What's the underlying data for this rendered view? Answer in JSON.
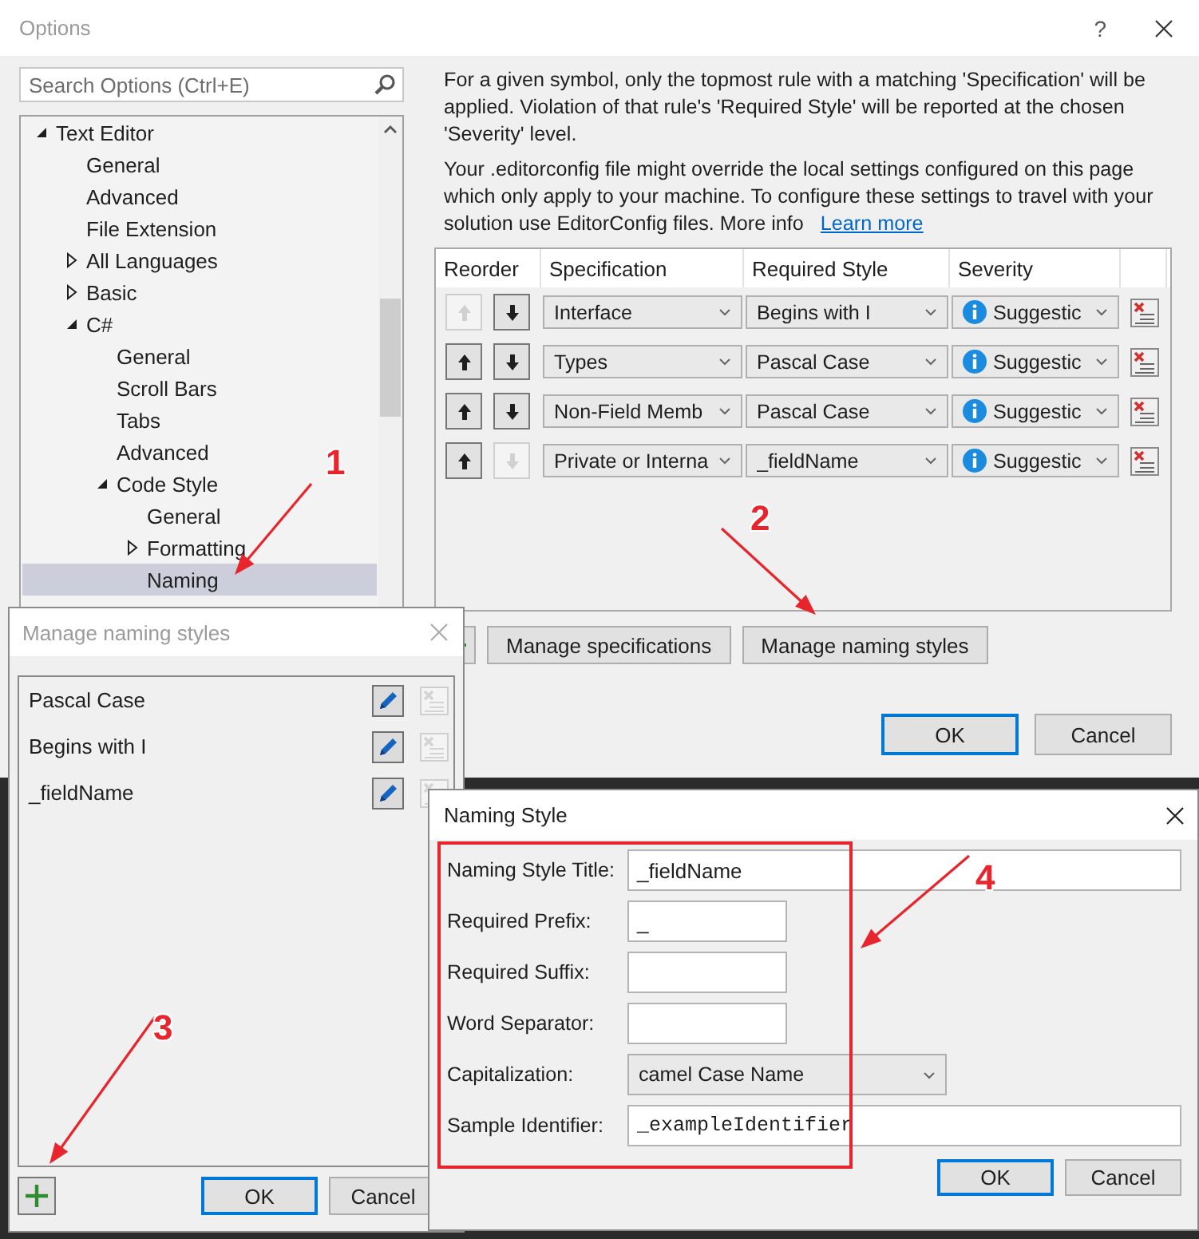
{
  "options_window": {
    "title": "Options",
    "help": "?",
    "search": {
      "placeholder": "Search Options (Ctrl+E)"
    },
    "tree": [
      {
        "label": "Text Editor",
        "expanded": true,
        "selected": false,
        "children": [
          {
            "label": "General",
            "selected": false
          },
          {
            "label": "Advanced",
            "selected": false
          },
          {
            "label": "File Extension",
            "selected": false
          },
          {
            "label": "All Languages",
            "expanded": false,
            "selected": false
          },
          {
            "label": "Basic",
            "expanded": false,
            "selected": false
          },
          {
            "label": "C#",
            "expanded": true,
            "selected": false,
            "children": [
              {
                "label": "General",
                "selected": false
              },
              {
                "label": "Scroll Bars",
                "selected": false
              },
              {
                "label": "Tabs",
                "selected": false
              },
              {
                "label": "Advanced",
                "selected": false
              },
              {
                "label": "Code Style",
                "expanded": true,
                "selected": false,
                "children": [
                  {
                    "label": "General",
                    "selected": false
                  },
                  {
                    "label": "Formatting",
                    "expanded": false,
                    "selected": false
                  },
                  {
                    "label": "Naming",
                    "selected": true
                  }
                ]
              }
            ]
          }
        ]
      }
    ],
    "description": "For a given symbol, only the topmost rule with a matching 'Specification' will be applied. Violation of that rule's 'Required Style' will be reported at the chosen 'Severity' level.",
    "editorconfig_note": {
      "text": "Your .editorconfig file might override the local settings configured on this page which only apply to your machine. To configure these settings to travel with your solution use EditorConfig files. More info",
      "link": "Learn more"
    },
    "table": {
      "columns": [
        "Reorder",
        "Specification",
        "Required Style",
        "Severity"
      ],
      "rows": [
        {
          "up_disabled": true,
          "down_disabled": false,
          "specification": "Interface",
          "required_style": "Begins with I",
          "severity": "Suggestic"
        },
        {
          "up_disabled": false,
          "down_disabled": false,
          "specification": "Types",
          "required_style": "Pascal Case",
          "severity": "Suggestic"
        },
        {
          "up_disabled": false,
          "down_disabled": false,
          "specification": "Non-Field Memb",
          "required_style": "Pascal Case",
          "severity": "Suggestic"
        },
        {
          "up_disabled": false,
          "down_disabled": true,
          "specification": "Private or Interna",
          "required_style": "_fieldName",
          "severity": "Suggestic"
        }
      ]
    },
    "buttons": [
      "Manage specifications",
      "Manage naming styles"
    ],
    "ok": "OK",
    "cancel": "Cancel"
  },
  "manage_dialog": {
    "title": "Manage naming styles",
    "styles": [
      {
        "name": "Pascal Case"
      },
      {
        "name": "Begins with I"
      },
      {
        "name": "_fieldName"
      }
    ],
    "ok": "OK",
    "cancel": "Cancel"
  },
  "naming_style_dialog": {
    "title": "Naming Style",
    "fields": [
      {
        "kind": "wide",
        "label": "Naming Style Title:",
        "value": "_fieldName"
      },
      {
        "kind": "short",
        "label": "Required Prefix:",
        "value": "_"
      },
      {
        "kind": "short",
        "label": "Required Suffix:"
      },
      {
        "kind": "short",
        "label": "Word Separator:"
      },
      {
        "kind": "combo",
        "label": "Capitalization:",
        "value": "camel Case Name"
      },
      {
        "kind": "mono",
        "label": "Sample Identifier:",
        "value": "_exampleIdentifier"
      }
    ],
    "ok": "OK",
    "cancel": "Cancel"
  },
  "annotations": [
    {
      "label": "1"
    },
    {
      "label": "2"
    },
    {
      "label": "3"
    },
    {
      "label": "4"
    }
  ]
}
